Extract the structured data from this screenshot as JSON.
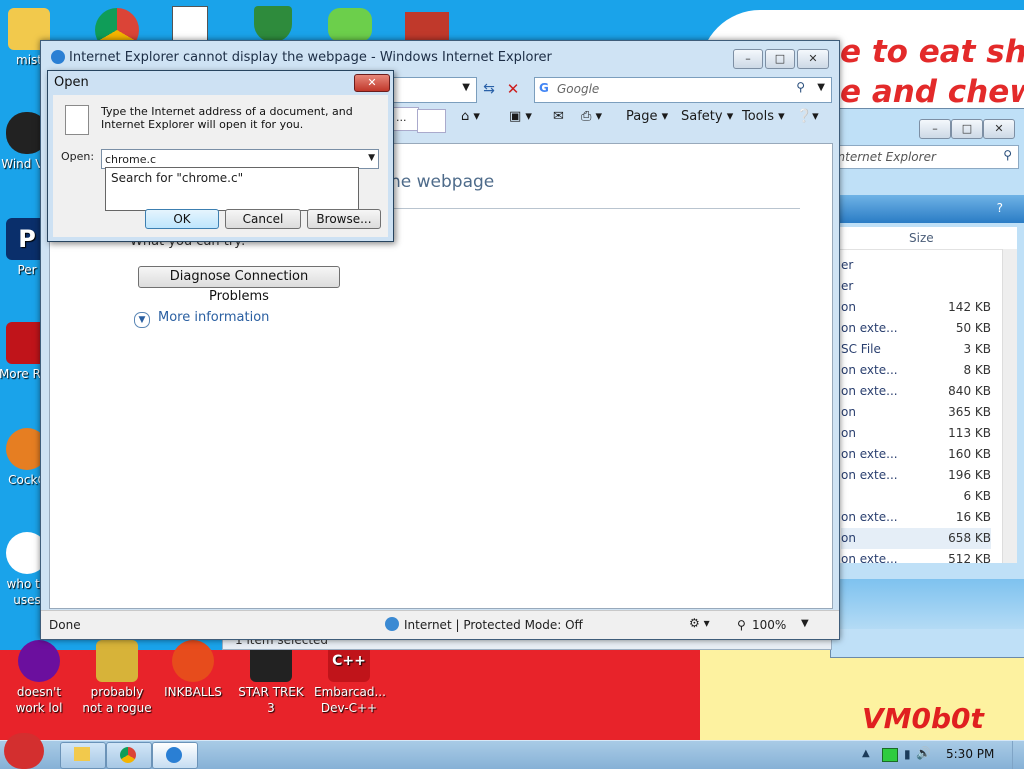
{
  "wallpaper": {
    "line1": "e to eat shit",
    "line2": "e and chew",
    "signature": "VM0b0t"
  },
  "desktop_icons": [
    {
      "label": "mist",
      "icon": "folder-icon"
    },
    {
      "label": "Wind Vis",
      "icon": "disk-icon"
    },
    {
      "label": "Per",
      "icon": "photoshop-icon"
    },
    {
      "label": "More Rea",
      "icon": "pdf-icon"
    },
    {
      "label": "CockC",
      "icon": "cockc-icon"
    },
    {
      "label": "who th uses",
      "icon": "lightning-icon"
    },
    {
      "label": "doesn't work lol",
      "icon": "yahoo-icon"
    },
    {
      "label": "probably not a rogue",
      "icon": "gears-icon"
    },
    {
      "label": "INKBALLS",
      "icon": "ball-icon"
    },
    {
      "label": "STAR TREK 3",
      "icon": "star-wars-icon"
    },
    {
      "label": "Embarcad... Dev-C++",
      "icon": "devcpp-icon"
    }
  ],
  "ie": {
    "title": "Internet Explorer cannot display the webpage - Windows Internet Explorer",
    "search_placeholder": "Google",
    "tab_label": "...",
    "toolbar": {
      "page": "Page",
      "safety": "Safety",
      "tools": "Tools"
    },
    "heading": "he webpage",
    "what_you_can_try": "What you can try:",
    "diagnose_button": "Diagnose Connection Problems",
    "more_info": "More information",
    "status": {
      "left": "Done",
      "zone": "Internet | Protected Mode: Off",
      "zoom": "100%"
    }
  },
  "dialog": {
    "title": "Open",
    "description": "Type the Internet address of a document, and Internet Explorer will open it for you.",
    "open_label": "Open:",
    "input_value": "chrome.c",
    "autocomplete": "Search for \"chrome.c\"",
    "ok": "OK",
    "cancel": "Cancel",
    "browse": "Browse..."
  },
  "explorer": {
    "search_placeholder": "Internet Explorer",
    "size_header": "Size",
    "rows": [
      {
        "name": "er",
        "size": ""
      },
      {
        "name": "er",
        "size": ""
      },
      {
        "name": "on",
        "size": "142 KB"
      },
      {
        "name": "on exte...",
        "size": "50 KB"
      },
      {
        "name": "SC File",
        "size": "3 KB"
      },
      {
        "name": "on exte...",
        "size": "8 KB"
      },
      {
        "name": "on exte...",
        "size": "840 KB"
      },
      {
        "name": "on",
        "size": "365 KB"
      },
      {
        "name": "on",
        "size": "113 KB"
      },
      {
        "name": "on exte...",
        "size": "160 KB"
      },
      {
        "name": "on exte...",
        "size": "196 KB"
      },
      {
        "name": "",
        "size": "6 KB"
      },
      {
        "name": "on exte...",
        "size": "16 KB"
      },
      {
        "name": "on",
        "size": "658 KB"
      },
      {
        "name": "on exte...",
        "size": "512 KB"
      }
    ],
    "status": "1 item selected"
  },
  "taskbar": {
    "clock": "5:30 PM"
  }
}
